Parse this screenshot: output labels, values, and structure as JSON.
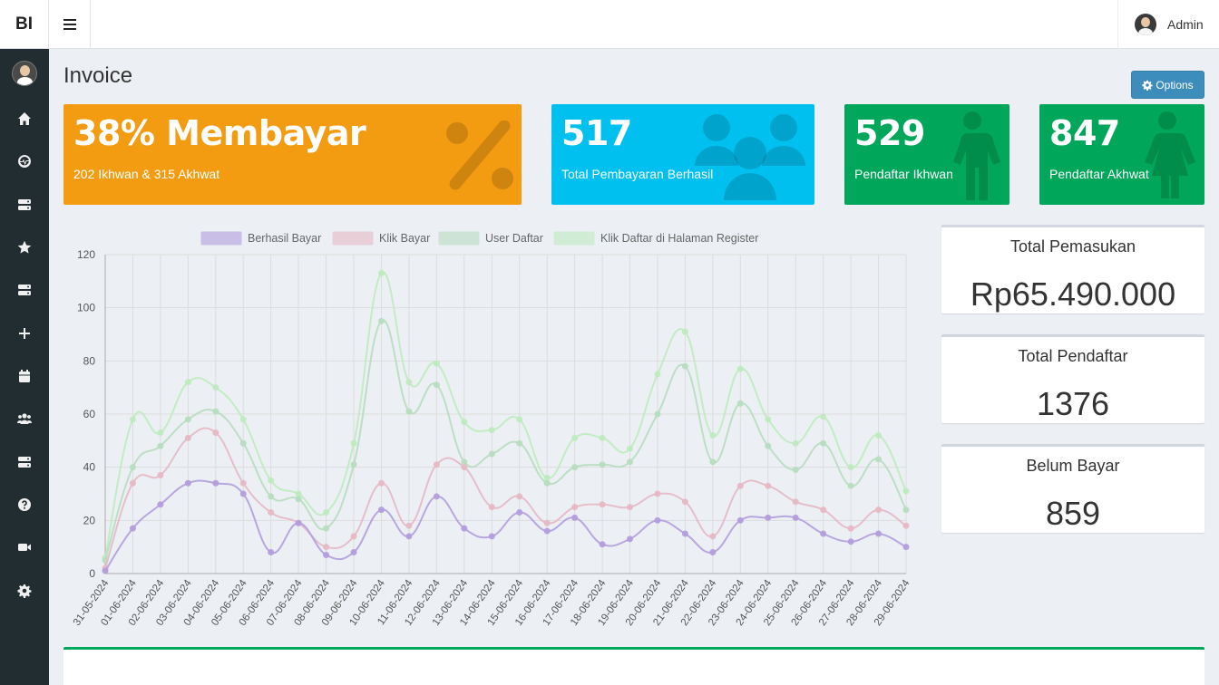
{
  "topbar": {
    "brand": "BI",
    "menu_icon": "hamburger-icon",
    "user_name": "Admin"
  },
  "sidebar": {
    "icons": [
      "home-icon",
      "dashboard-icon",
      "server-icon",
      "star-icon",
      "server-icon",
      "plus-icon",
      "calendar-icon",
      "users-icon",
      "server-icon",
      "question-icon",
      "video-icon",
      "gear-icon"
    ]
  },
  "page": {
    "title": "Invoice",
    "options_label": "Options"
  },
  "stats": {
    "paid_percent": {
      "value": "38% Membayar",
      "label": "202 Ikhwan & 315 Akhwat",
      "color": "#f39c12",
      "icon": "percent-icon"
    },
    "total_paid": {
      "value": "517",
      "label": "Total Pembayaran Berhasil",
      "color": "#00c0ef",
      "icon": "users-icon"
    },
    "ikhwan": {
      "value": "529",
      "label": "Pendaftar Ikhwan",
      "color": "#00a65a",
      "icon": "male-icon"
    },
    "akhwat": {
      "value": "847",
      "label": "Pendaftar Akhwat",
      "color": "#00a65a",
      "icon": "female-icon"
    }
  },
  "summary": {
    "income": {
      "title": "Total Pemasukan",
      "value": "Rp65.490.000"
    },
    "registrants": {
      "title": "Total Pendaftar",
      "value": "1376"
    },
    "unpaid": {
      "title": "Belum Bayar",
      "value": "859"
    }
  },
  "chart_data": {
    "type": "line",
    "ylim": [
      0,
      120
    ],
    "yticks": [
      0,
      20,
      40,
      60,
      80,
      100,
      120
    ],
    "grid": true,
    "legend_position": "top",
    "categories": [
      "31-05-2024",
      "01-06-2024",
      "02-06-2024",
      "03-06-2024",
      "04-06-2024",
      "05-06-2024",
      "06-06-2024",
      "07-06-2024",
      "08-06-2024",
      "09-06-2024",
      "10-06-2024",
      "11-06-2024",
      "12-06-2024",
      "13-06-2024",
      "14-06-2024",
      "15-06-2024",
      "16-06-2024",
      "17-06-2024",
      "18-06-2024",
      "19-06-2024",
      "20-06-2024",
      "21-06-2024",
      "22-06-2024",
      "23-06-2024",
      "24-06-2024",
      "25-06-2024",
      "26-06-2024",
      "27-06-2024",
      "28-06-2024",
      "29-06-2024"
    ],
    "series": [
      {
        "name": "Berhasil Bayar",
        "color": "#b39ddb",
        "values": [
          1,
          17,
          26,
          34,
          34,
          30,
          8,
          19,
          7,
          8,
          24,
          14,
          29,
          17,
          14,
          23,
          16,
          21,
          11,
          13,
          20,
          15,
          8,
          20,
          21,
          21,
          15,
          12,
          15,
          10
        ]
      },
      {
        "name": "Klik Bayar",
        "color": "#e6b8c4",
        "values": [
          2,
          34,
          37,
          51,
          53,
          34,
          23,
          19,
          10,
          14,
          34,
          18,
          41,
          40,
          25,
          29,
          19,
          25,
          26,
          25,
          30,
          27,
          14,
          33,
          33,
          27,
          24,
          17,
          24,
          18
        ]
      },
      {
        "name": "User Daftar",
        "color": "#b8dcc0",
        "values": [
          5,
          40,
          48,
          58,
          61,
          49,
          29,
          28,
          17,
          41,
          95,
          61,
          71,
          42,
          45,
          49,
          34,
          40,
          41,
          42,
          60,
          78,
          42,
          64,
          48,
          39,
          49,
          33,
          43,
          24
        ]
      },
      {
        "name": "Klik Daftar di Halaman Register",
        "color": "#bfeabf",
        "values": [
          6,
          58,
          53,
          72,
          70,
          58,
          35,
          30,
          23,
          49,
          113,
          72,
          79,
          57,
          54,
          58,
          36,
          51,
          51,
          47,
          75,
          91,
          52,
          77,
          58,
          49,
          59,
          40,
          52,
          31
        ]
      }
    ]
  },
  "bottom": {
    "accent": "#00a65a"
  }
}
